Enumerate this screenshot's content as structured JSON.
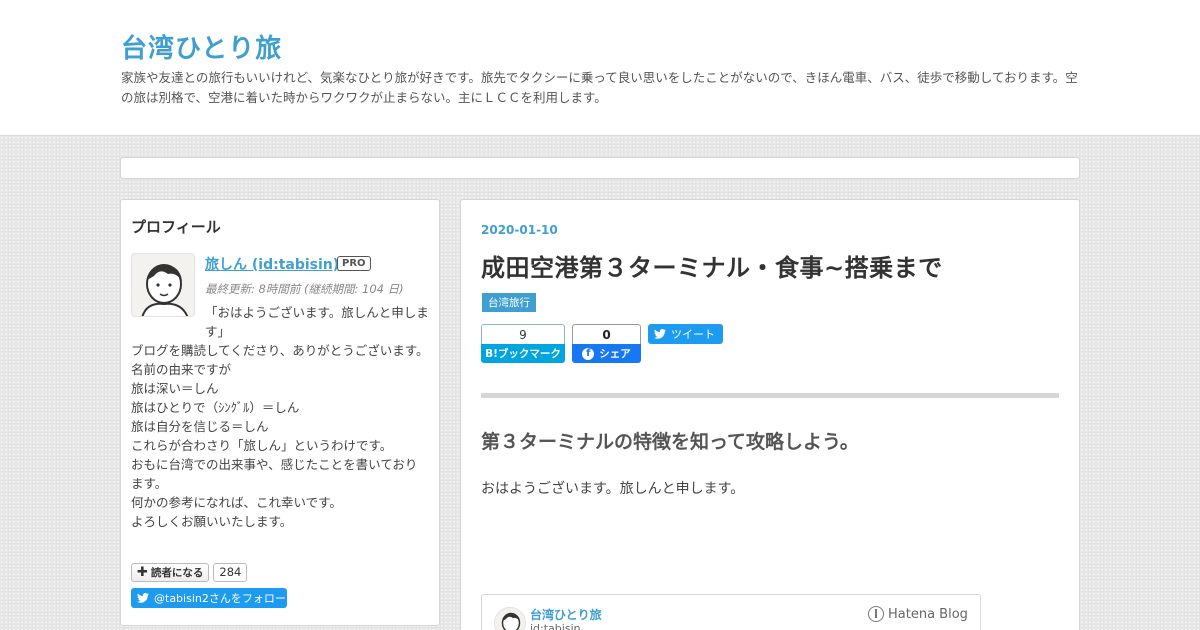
{
  "header": {
    "blog_title": "台湾ひとり旅",
    "description": "家族や友達との旅行もいいけれど、気楽なひとり旅が好きです。旅先でタクシーに乗って良い思いをしたことがないので、きほん電車、バス、徒歩で移動しております。空の旅は別格で、空港に着いた時からワクワクが止まらない。主にＬＣＣを利用します。"
  },
  "sidebar": {
    "module_title": "プロフィール",
    "profile": {
      "name": "旅しん (id:tabisin)",
      "badge": "PRO",
      "updated": "最終更新: 8時間前 (継続期間: 104 日)",
      "greeting": "「おはようございます。旅しんと申します」",
      "lines": [
        "ブログを購読してくださり、ありがとうございます。",
        "名前の由来ですが",
        "旅は深い＝しん",
        "旅はひとりで（ｼﾝｸﾞﾙ）＝しん",
        "旅は自分を信じる＝しん",
        "これらが合わさり「旅しん」というわけです。",
        "おもに台湾での出来事や、感じたことを書いております。",
        "何かの参考になれば、これ幸いです。",
        "よろしくお願いいたします。"
      ]
    },
    "reader_button": "読者になる",
    "reader_count": "284",
    "twitter_follow": "@tabisin2さんをフォロー",
    "colors": {
      "accent": "#3f9fd1",
      "twitter": "#1d9bf0"
    }
  },
  "entry": {
    "date": "2020-01-10",
    "title": "成田空港第３ターミナル・食事~搭乗まで",
    "category": "台湾旅行",
    "share": {
      "hatena_count": "9",
      "hatena_label": "B!ブックマーク",
      "facebook_count": "0",
      "facebook_label": "シェア",
      "tweet_label": "ツイート"
    },
    "section_heading": "第３ターミナルの特徴を知って攻略しよう。",
    "body": "おはようございます。旅しんと申します。",
    "embed": {
      "blog_name": "台湾ひとり旅",
      "blog_id": "id:tabisin",
      "service": "Hatena Blog"
    }
  },
  "icons": [
    "avatar-illustration",
    "plus-icon",
    "twitter-bird-icon",
    "facebook-icon",
    "hatena-blog-icon"
  ]
}
